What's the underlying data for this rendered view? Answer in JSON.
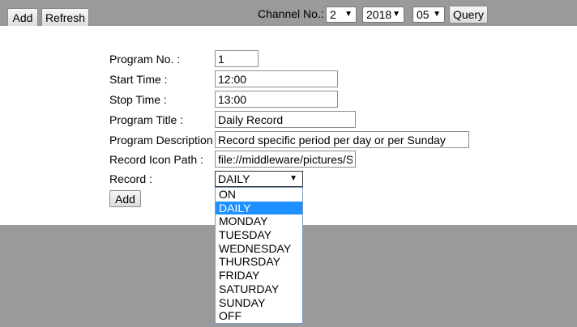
{
  "toolbar": {
    "add_label": "Add",
    "refresh_label": "Refresh",
    "channel_label": "Channel No.:",
    "channel_value": "2",
    "year_value": "2018",
    "month_value": "05",
    "query_label": "Query"
  },
  "form": {
    "program_no_label": "Program No. :",
    "program_no_value": "1",
    "start_time_label": "Start Time :",
    "start_time_value": "12:00",
    "stop_time_label": "Stop Time :",
    "stop_time_value": "13:00",
    "program_title_label": "Program Title :",
    "program_title_value": "Daily Record",
    "program_description_label": "Program Description :",
    "program_description_value": "Record specific period per day or per Sunday",
    "record_icon_path_label": "Record Icon Path :",
    "record_icon_path_value": "file://middleware/pictures/SpecialRecord.png",
    "record_label": "Record :",
    "record_value": "DAILY",
    "add_label": "Add"
  },
  "record_options": [
    "ON",
    "DAILY",
    "MONDAY",
    "TUESDAY",
    "WEDNESDAY",
    "THURSDAY",
    "FRIDAY",
    "SATURDAY",
    "SUNDAY",
    "OFF"
  ],
  "record_selected": "DAILY",
  "colors": {
    "background": "#9a9a9a",
    "panel": "#ffffff",
    "highlight": "#1e90ff"
  },
  "icons": {
    "dropdown_arrow": "chevron-down-icon"
  }
}
